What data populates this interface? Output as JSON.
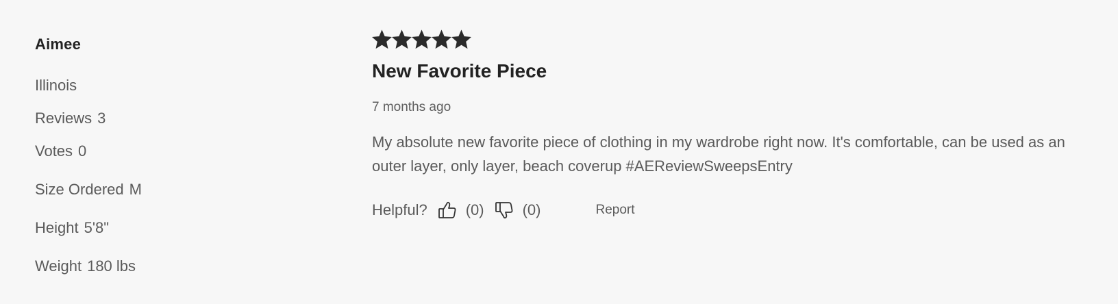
{
  "reviewer": {
    "name": "Aimee",
    "location": "Illinois",
    "reviews_label": "Reviews",
    "reviews_value": "3",
    "votes_label": "Votes",
    "votes_value": "0",
    "size_label": "Size Ordered",
    "size_value": "M",
    "height_label": "Height",
    "height_value": "5'8\"",
    "weight_label": "Weight",
    "weight_value": "180 lbs"
  },
  "review": {
    "rating": 5,
    "rating_max": 5,
    "title": "New Favorite Piece",
    "date": "7 months ago",
    "body": "My absolute new favorite piece of clothing in my wardrobe right now. It's comfortable, can be used as an outer layer, only layer, beach coverup #AEReviewSweepsEntry",
    "helpful_label": "Helpful?",
    "helpful_yes_count": "(0)",
    "helpful_no_count": "(0)",
    "report_label": "Report"
  },
  "icons": {
    "star": "star-icon",
    "thumbs_up": "thumbs-up-icon",
    "thumbs_down": "thumbs-down-icon"
  },
  "colors": {
    "background": "#f7f7f7",
    "heading": "#222222",
    "text": "#5a5a5a",
    "star": "#2b2b2b"
  }
}
